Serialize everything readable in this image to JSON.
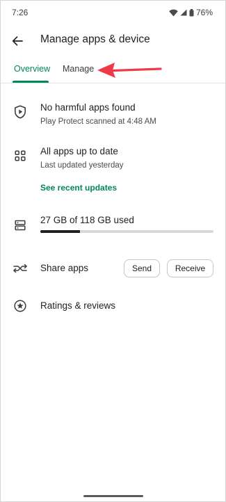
{
  "status_bar": {
    "time": "7:26",
    "battery": "76%"
  },
  "app_bar": {
    "title": "Manage apps & device"
  },
  "tabs": [
    {
      "label": "Overview",
      "selected": true
    },
    {
      "label": "Manage",
      "selected": false
    }
  ],
  "accent_color": "#01875f",
  "annotation_color": "#ef3a4a",
  "protect": {
    "title": "No harmful apps found",
    "subtitle": "Play Protect scanned at 4:48 AM",
    "icon": "shield-play-icon"
  },
  "updates": {
    "title": "All apps up to date",
    "subtitle": "Last updated yesterday",
    "link": "See recent updates",
    "icon": "apps-grid-icon"
  },
  "storage": {
    "title": "27 GB of 118 GB used",
    "used_gb": 27,
    "total_gb": 118,
    "icon": "storage-icon"
  },
  "share": {
    "title": "Share apps",
    "send_label": "Send",
    "receive_label": "Receive",
    "icon": "share-arrows-icon"
  },
  "ratings": {
    "title": "Ratings & reviews",
    "icon": "star-circle-icon"
  }
}
